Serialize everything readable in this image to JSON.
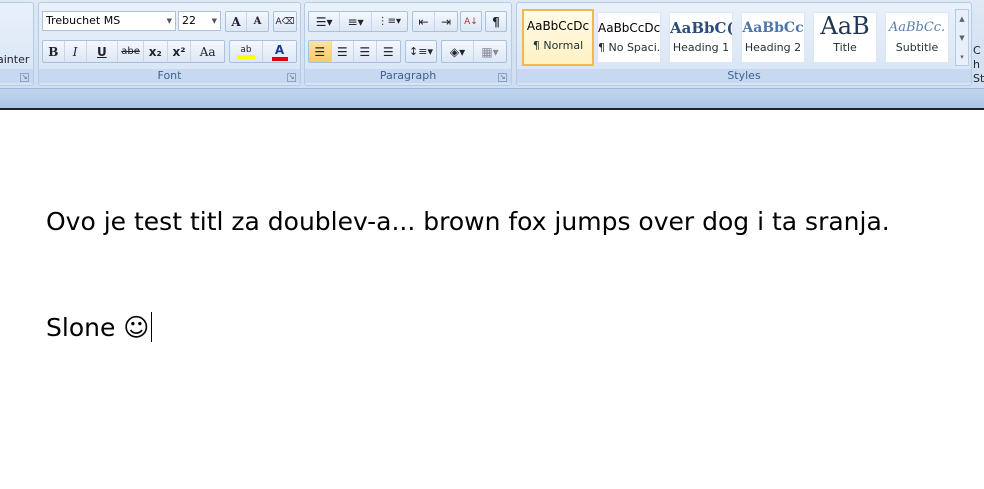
{
  "clipboard": {
    "painter_label": "ainter"
  },
  "font": {
    "label": "Font",
    "font_name": "Trebuchet MS",
    "font_size": "22",
    "bold": "B",
    "italic": "I",
    "underline": "U",
    "strike": "abe",
    "subscript": "x₂",
    "superscript": "x²",
    "change_case": "Aa",
    "grow": "A",
    "shrink": "A",
    "highlight": "ab",
    "font_color": "A",
    "highlight_color": "#ffff00",
    "font_color_value": "#e00000"
  },
  "paragraph": {
    "label": "Paragraph",
    "sort": "A↓",
    "pilcrow": "¶"
  },
  "styles": {
    "label": "Styles",
    "items": [
      {
        "preview": "AaBbCcDc",
        "name": "¶ Normal"
      },
      {
        "preview": "AaBbCcDc",
        "name": "¶ No Spaci..."
      },
      {
        "preview": "AaBbC(",
        "name": "Heading 1"
      },
      {
        "preview": "AaBbCc",
        "name": "Heading 2"
      },
      {
        "preview": "AaB",
        "name": "Title"
      },
      {
        "preview": "AaBbCc.",
        "name": "Subtitle"
      }
    ],
    "change_styles": "Ch St"
  },
  "document": {
    "line1": "Ovo je test titl za doublev-a... brown fox jumps over dog i ta sranja.",
    "line2": "Slone ☺"
  }
}
